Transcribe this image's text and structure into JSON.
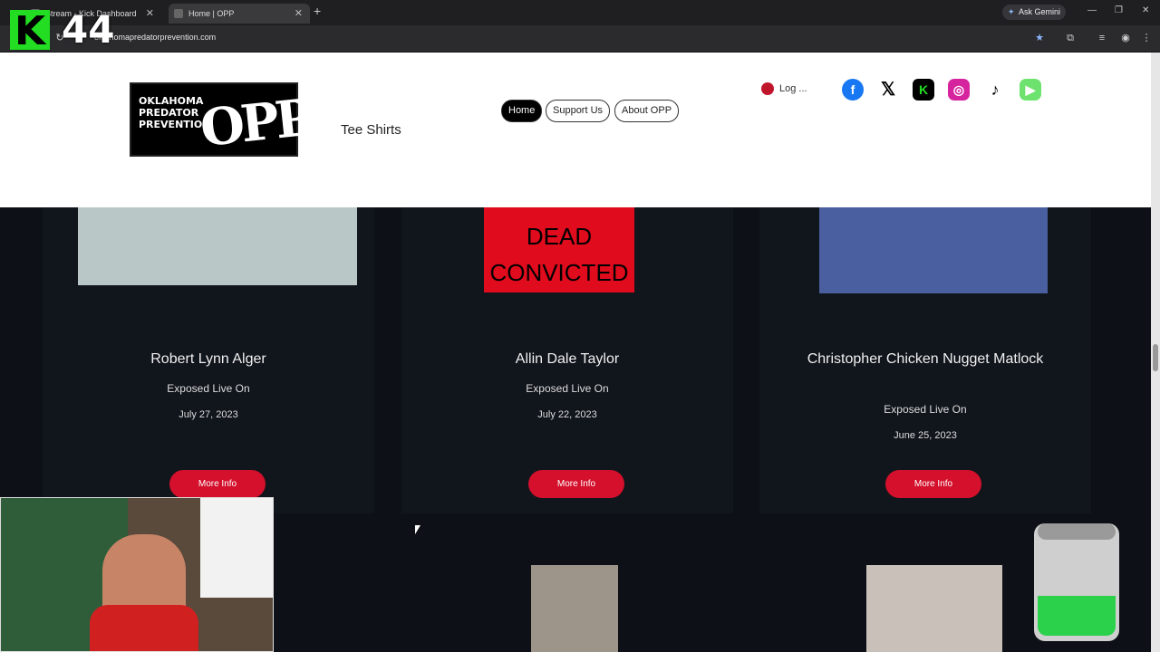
{
  "browser": {
    "tabs": [
      {
        "label": "Stream - Kick Dashboard"
      },
      {
        "label": "Home | OPP"
      }
    ],
    "url": "oklahomapredatorprevention.com",
    "gemini_label": "Ask Gemini"
  },
  "overlay": {
    "kick_count": "44"
  },
  "site": {
    "logo_text": "OKLAHOMA PREDATOR PREVENTION",
    "logo_mark": "OPP",
    "tee_shirts": "Tee Shirts",
    "nav": [
      {
        "label": "Home"
      },
      {
        "label": "Support Us"
      },
      {
        "label": "About OPP"
      }
    ],
    "login": "Log ..."
  },
  "cards": [
    {
      "name": "Robert Lynn Alger",
      "exposed": "Exposed Live On",
      "date": "July 27, 2023",
      "button": "More Info"
    },
    {
      "name": "Allin Dale Taylor",
      "exposed": "Exposed Live On",
      "date": "July 22, 2023",
      "button": "More Info",
      "banner_line1": "DEAD",
      "banner_line2": "CONVICTED"
    },
    {
      "name": "Christopher Chicken Nugget Matlock",
      "exposed": "Exposed Live On",
      "date": "June 25, 2023",
      "button": "More Info"
    }
  ],
  "colors": {
    "accent_red": "#d4102c",
    "page_bg": "#0d1016",
    "kick_green": "#22dd22"
  }
}
